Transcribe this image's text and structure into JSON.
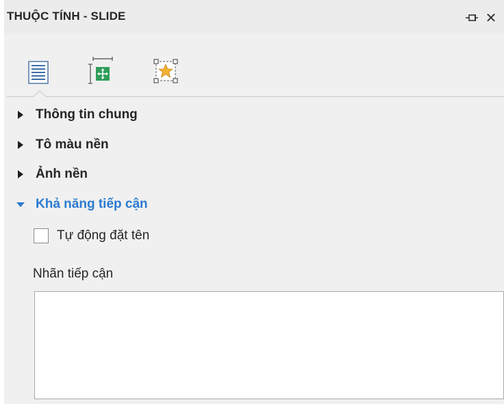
{
  "panel": {
    "title": "THUỘC TÍNH - SLIDE",
    "pin_icon": "pin-icon",
    "close_glyph": "✕"
  },
  "tabs": [
    {
      "icon": "list-properties-icon",
      "selected": true
    },
    {
      "icon": "size-position-icon",
      "selected": false
    },
    {
      "icon": "effects-star-icon",
      "selected": false
    }
  ],
  "sections": [
    {
      "label": "Thông tin chung",
      "expanded": false
    },
    {
      "label": "Tô màu nền",
      "expanded": false
    },
    {
      "label": "Ảnh nền",
      "expanded": false
    },
    {
      "label": "Khả năng tiếp cận",
      "expanded": true
    }
  ],
  "accessibility": {
    "auto_name_label": "Tự động đặt tên",
    "auto_name_checked": false,
    "alt_label": "Nhãn tiếp cận",
    "alt_value": ""
  },
  "colors": {
    "expanded_header": "#2b7bd0",
    "pane_background": "#f0f0f0"
  }
}
